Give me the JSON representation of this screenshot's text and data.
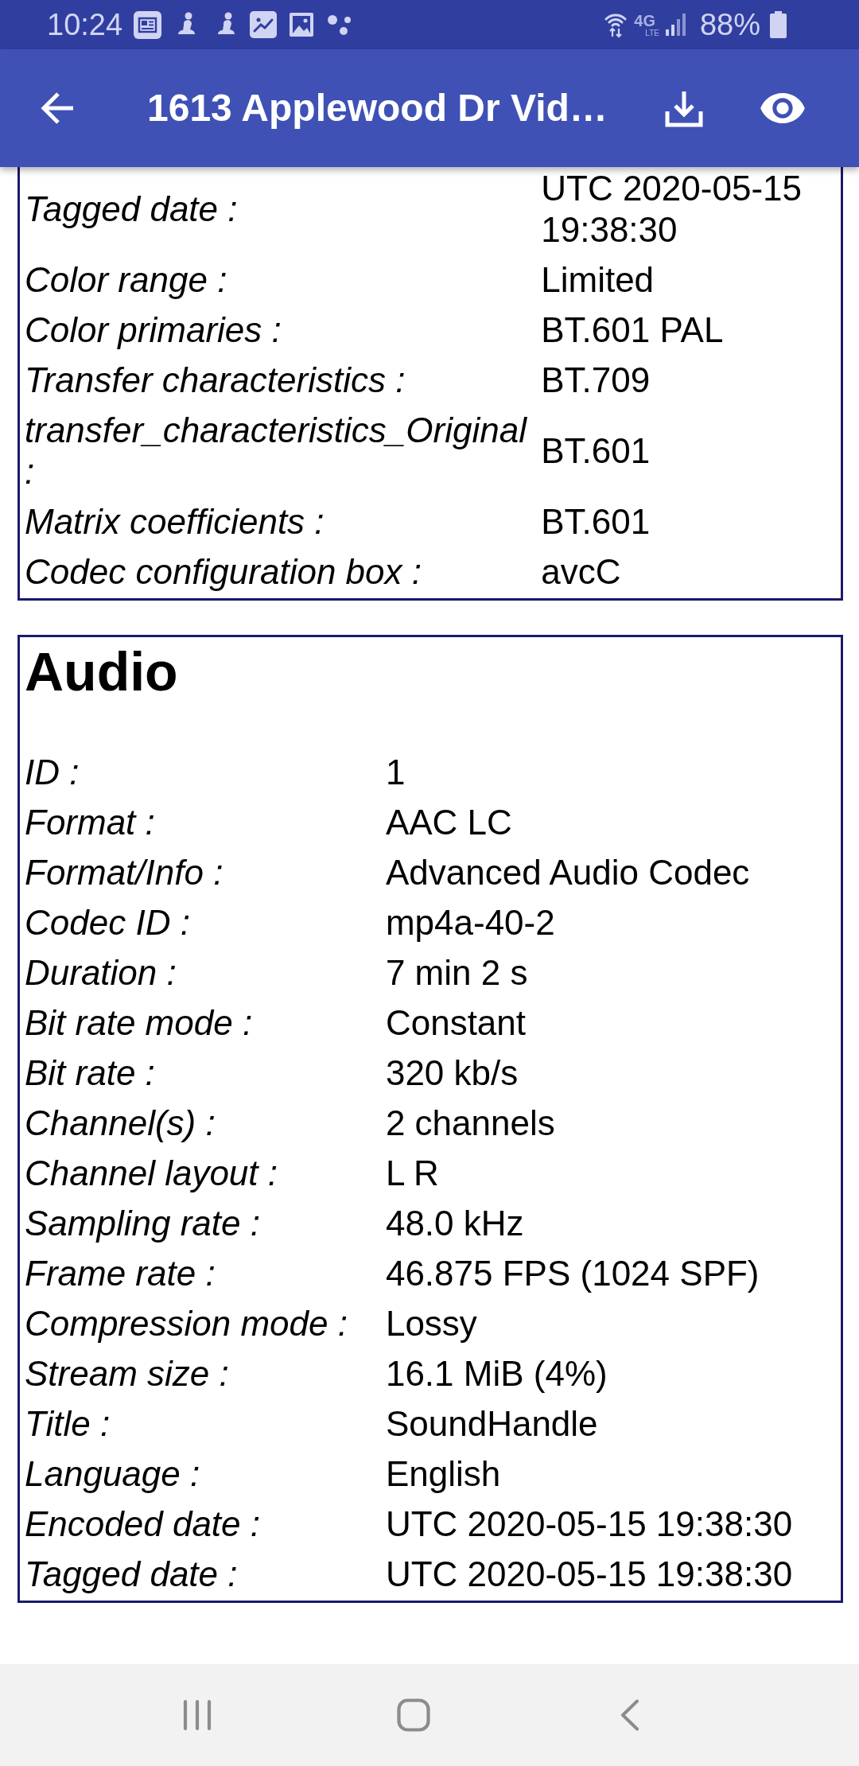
{
  "status_bar": {
    "time": "10:24",
    "network": "4G",
    "network_detail": "LTE",
    "battery": "88%"
  },
  "app_bar": {
    "title": "1613 Applewood Dr Vid…"
  },
  "sections": [
    {
      "rows": [
        {
          "label": "Tagged date :",
          "value": "UTC 2020-05-15 19:38:30"
        },
        {
          "label": "Color range :",
          "value": "Limited"
        },
        {
          "label": "Color primaries :",
          "value": "BT.601 PAL"
        },
        {
          "label": "Transfer characteristics :",
          "value": "BT.709"
        },
        {
          "label": "transfer_characteristics_Original :",
          "value": "BT.601"
        },
        {
          "label": "Matrix coefficients :",
          "value": "BT.601"
        },
        {
          "label": "Codec configuration box :",
          "value": "avcC"
        }
      ]
    },
    {
      "heading": "Audio",
      "rows": [
        {
          "label": "ID :",
          "value": "1"
        },
        {
          "label": "Format :",
          "value": "AAC LC"
        },
        {
          "label": "Format/Info :",
          "value": "Advanced Audio Codec"
        },
        {
          "label": "Codec ID :",
          "value": "mp4a-40-2"
        },
        {
          "label": "Duration :",
          "value": "7 min 2 s"
        },
        {
          "label": "Bit rate mode :",
          "value": "Constant"
        },
        {
          "label": "Bit rate :",
          "value": "320 kb/s"
        },
        {
          "label": "Channel(s) :",
          "value": "2 channels"
        },
        {
          "label": "Channel layout :",
          "value": "L R"
        },
        {
          "label": "Sampling rate :",
          "value": "48.0 kHz"
        },
        {
          "label": "Frame rate :",
          "value": "46.875 FPS (1024 SPF)"
        },
        {
          "label": "Compression mode :",
          "value": "Lossy"
        },
        {
          "label": "Stream size :",
          "value": "16.1 MiB (4%)"
        },
        {
          "label": "Title :",
          "value": "SoundHandle"
        },
        {
          "label": "Language :",
          "value": "English"
        },
        {
          "label": "Encoded date :",
          "value": "UTC 2020-05-15 19:38:30"
        },
        {
          "label": "Tagged date :",
          "value": "UTC 2020-05-15 19:38:30"
        }
      ]
    }
  ]
}
